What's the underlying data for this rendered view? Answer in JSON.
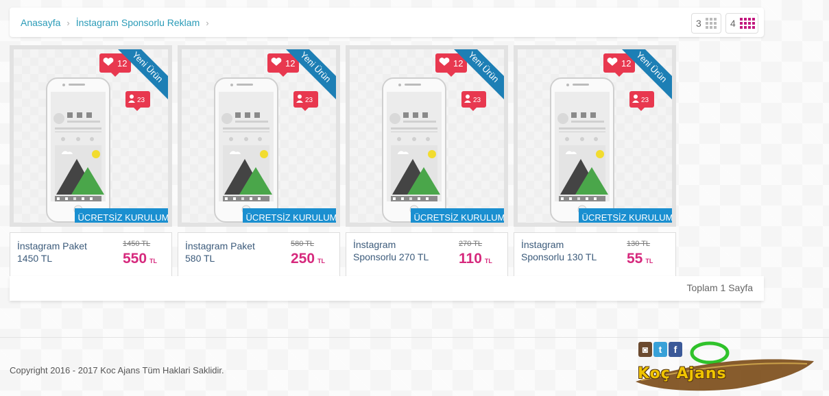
{
  "breadcrumb": {
    "items": [
      "Anasayfa",
      "İnstagram Sponsorlu Reklam"
    ]
  },
  "view_toggle": {
    "three": "3",
    "four": "4"
  },
  "badges": {
    "new_product": "Yeni Ürün",
    "free_setup": "ÜCRETSİZ KURULUM",
    "likes": "12",
    "followers": "23"
  },
  "currency": "TL",
  "products": [
    {
      "name": "İnstagram Paket 1450 TL",
      "old_price": "1450 TL",
      "price": "550"
    },
    {
      "name": "İnstagram Paket 580 TL",
      "old_price": "580 TL",
      "price": "250"
    },
    {
      "name": "İnstagram Sponsorlu 270 TL",
      "old_price": "270 TL",
      "price": "110"
    },
    {
      "name": "İnstagram Sponsorlu 130 TL",
      "old_price": "130 TL",
      "price": "55"
    }
  ],
  "pager": {
    "text": "Toplam 1 Sayfa"
  },
  "footer": {
    "copyright": "Copyright 2016 - 2017 Koc Ajans Tüm Haklari Saklidir.",
    "logo_text": "Koç Ajans"
  },
  "colors": {
    "accent_link": "#2a9bb7",
    "price": "#d6297d",
    "ribbon": "#1d7fb5",
    "free_setup": "#1a8fd0",
    "grid_active": "#c2187e"
  },
  "icons": {
    "breadcrumb_separator": "chevron-right-icon",
    "grid3": "grid-3-icon",
    "grid4": "grid-4-icon",
    "like": "heart-icon",
    "follower": "user-icon",
    "instagram": "instagram-icon",
    "twitter": "twitter-icon",
    "facebook": "facebook-icon"
  }
}
